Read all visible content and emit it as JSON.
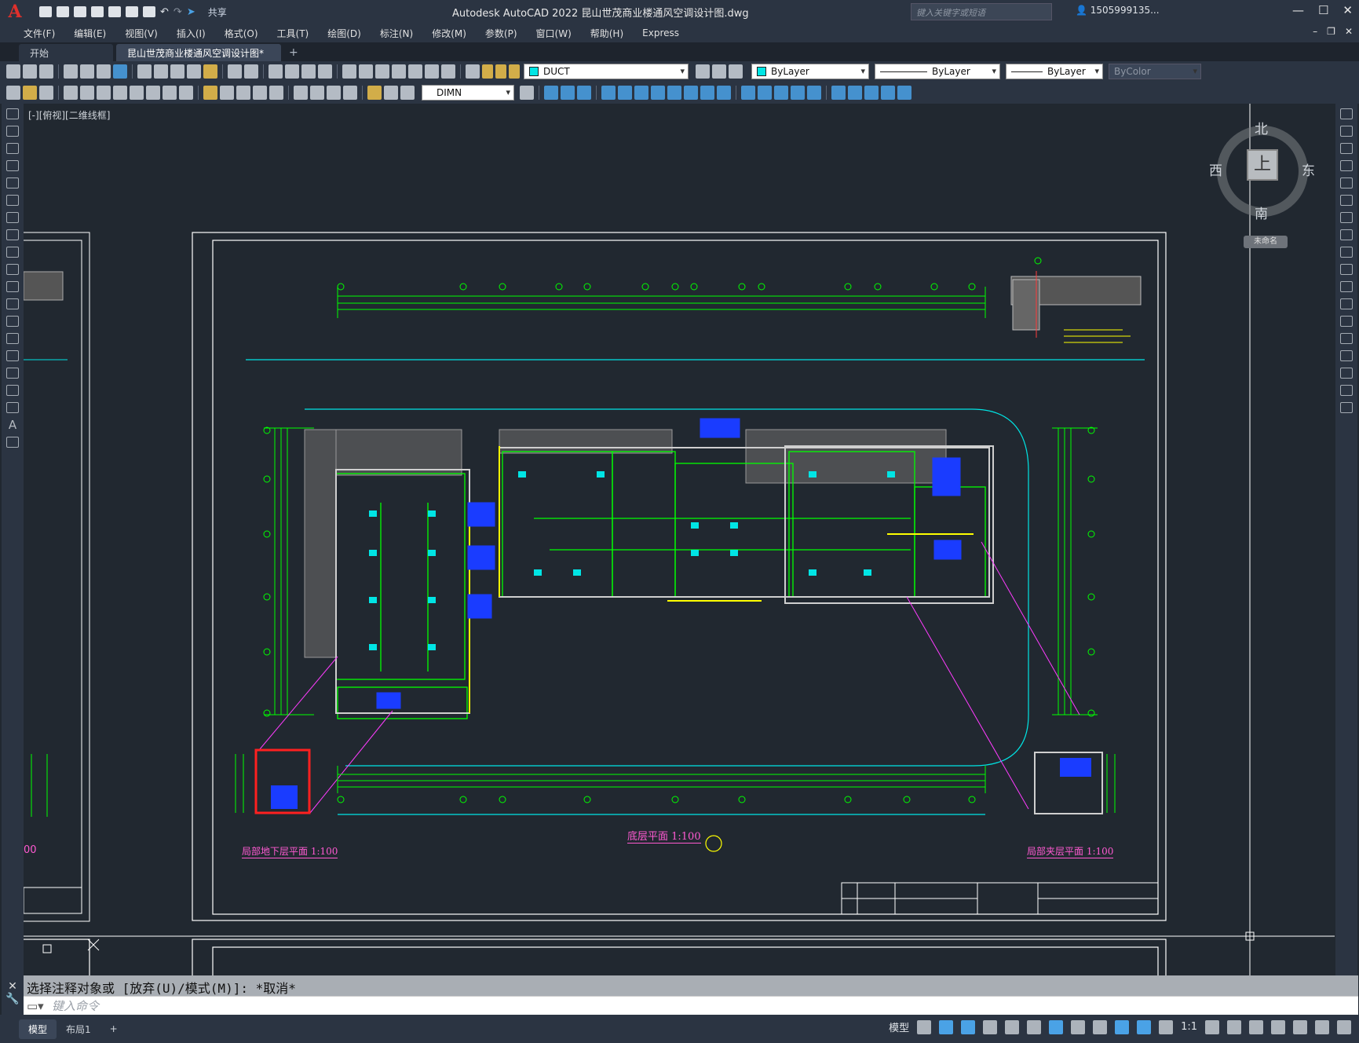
{
  "titlebar": {
    "app_letter": "A",
    "share": "共享",
    "title": "Autodesk AutoCAD 2022    昆山世茂商业楼通风空调设计图.dwg",
    "search_placeholder": "键入关键字或短语",
    "user": "1505999135...",
    "help": "?"
  },
  "menu": [
    "文件(F)",
    "编辑(E)",
    "视图(V)",
    "插入(I)",
    "格式(O)",
    "工具(T)",
    "绘图(D)",
    "标注(N)",
    "修改(M)",
    "参数(P)",
    "窗口(W)",
    "帮助(H)",
    "Express"
  ],
  "tabs": {
    "start": "开始",
    "doc": "昆山世茂商业楼通风空调设计图*",
    "close": "×",
    "add": "+"
  },
  "toolbar": {
    "layer_name": "DUCT",
    "color": "ByLayer",
    "linetype": "ByLayer",
    "lineweight": "ByLayer",
    "plotstyle": "ByColor",
    "dimstyle": "DIMN"
  },
  "viewport": {
    "label": "[-][俯视][二维线框]"
  },
  "viewcube": {
    "north": "北",
    "south": "南",
    "west": "西",
    "east": "东",
    "face": "上",
    "ucs": "未命名"
  },
  "drawing": {
    "main_title": "底层平面  1:100",
    "left_inset_title": "局部地下层平面  1:100",
    "right_inset_title": "局部夹层平面  1:100",
    "left_sheet_scale": "00"
  },
  "command": {
    "history": "选择注释对象或 [放弃(U)/模式(M)]: *取消*",
    "placeholder": "键入命令"
  },
  "status": {
    "model_label": "模型",
    "tab_model": "模型",
    "tab_layout1": "布局1",
    "add": "+",
    "scale": "1:1"
  },
  "colors": {
    "bg": "#212830",
    "chrome": "#2b3442",
    "green": "#00ff00",
    "cyan": "#00e5e5",
    "magenta": "#ff3cff",
    "yellow": "#ffff00",
    "blue": "#1a3cff"
  }
}
